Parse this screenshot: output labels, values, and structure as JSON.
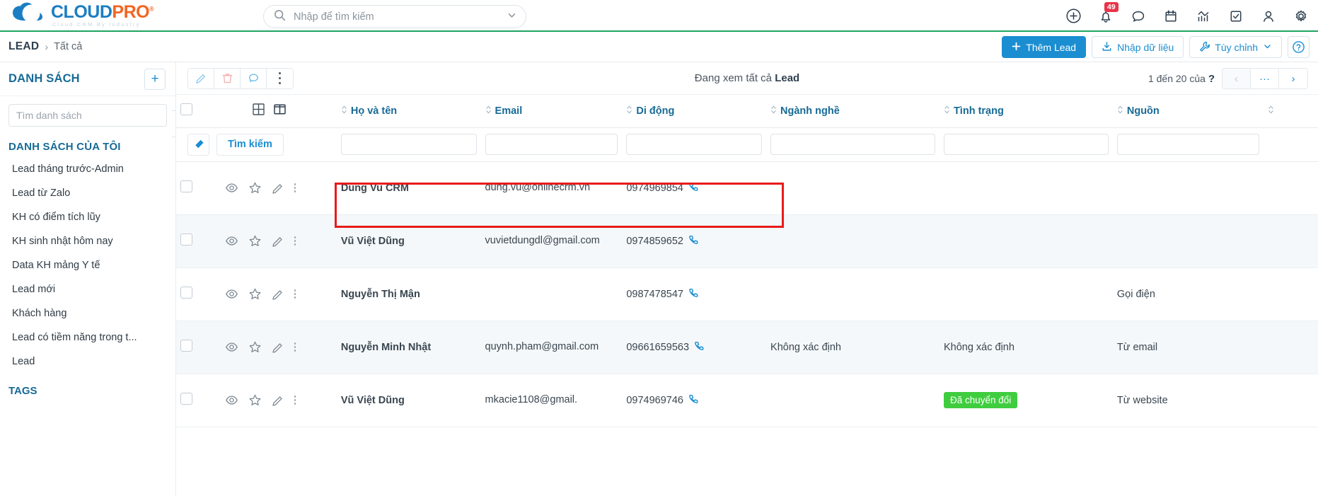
{
  "brand": {
    "name_part1": "CLOUD",
    "name_part2": "PRO",
    "registered": "®",
    "tagline": "Cloud CRM By Industry"
  },
  "search": {
    "placeholder": "Nhập để tìm kiếm",
    "value": "",
    "icon": "search-icon",
    "chevron": "chevron-down-icon"
  },
  "top_icons": [
    {
      "name": "add-circle-icon",
      "label": ""
    },
    {
      "name": "bell-icon",
      "label": "",
      "badge": "49"
    },
    {
      "name": "chat-icon",
      "label": ""
    },
    {
      "name": "calendar-icon",
      "label": ""
    },
    {
      "name": "analytics-icon",
      "label": ""
    },
    {
      "name": "task-check-icon",
      "label": ""
    },
    {
      "name": "user-icon",
      "label": ""
    },
    {
      "name": "gear-icon",
      "label": ""
    }
  ],
  "breadcrumb": {
    "root": "LEAD",
    "separator": "›",
    "current": "Tất cả"
  },
  "header_actions": {
    "add_lead": "Thêm Lead",
    "import": "Nhập dữ liệu",
    "customize": "Tùy chỉnh",
    "help": "?"
  },
  "sidebar": {
    "title": "DANH SÁCH",
    "add_button": "+",
    "search_placeholder": "Tìm danh sách",
    "search_value": "",
    "section_my_lists": "DANH SÁCH CỦA TÔI",
    "items": [
      {
        "label": "Lead tháng trước-Admin"
      },
      {
        "label": "Lead từ Zalo"
      },
      {
        "label": "KH có điểm tích lũy"
      },
      {
        "label": "KH sinh nhật hôm nay"
      },
      {
        "label": "Data KH mảng Y tế"
      },
      {
        "label": "Lead mới"
      },
      {
        "label": "Khách hàng"
      },
      {
        "label": "Lead có tiềm năng trong t..."
      },
      {
        "label": "Lead"
      }
    ],
    "section_tags": "TAGS"
  },
  "main": {
    "toolbar_icons": [
      {
        "name": "edit-pencil-icon"
      },
      {
        "name": "delete-trash-icon"
      },
      {
        "name": "comment-icon"
      },
      {
        "name": "more-vertical-icon"
      }
    ],
    "viewing_prefix": "Đang xem tất cả",
    "viewing_entity": "Lead",
    "pagination": {
      "range_prefix": "1 đến 20 của",
      "total": "?",
      "prev": "‹",
      "more": "···",
      "next": "›"
    },
    "filter": {
      "clear_icon": "eraser-icon",
      "search_label": "Tìm kiếm",
      "values": [
        "",
        "",
        "",
        "",
        "",
        "",
        ""
      ]
    },
    "columns": [
      {
        "key": "name",
        "label": "Họ và tên",
        "sortable": true
      },
      {
        "key": "email",
        "label": "Email",
        "sortable": true
      },
      {
        "key": "phone",
        "label": "Di động",
        "sortable": true
      },
      {
        "key": "industry",
        "label": "Ngành nghề",
        "sortable": true
      },
      {
        "key": "status",
        "label": "Tình trạng",
        "sortable": true
      },
      {
        "key": "source",
        "label": "Nguồn",
        "sortable": true
      }
    ],
    "rows": [
      {
        "name": "Dung Vu CRM",
        "email": "dung.vu@onlinecrm.vn",
        "phone": "0974969854",
        "industry": "",
        "status": "",
        "source": "",
        "extra": "",
        "highlighted": true
      },
      {
        "name": "Vũ Việt Dũng",
        "email": "vuvietdungdl@gmail.com",
        "phone": "0974859652",
        "industry": "",
        "status": "",
        "source": "",
        "extra": "",
        "highlighted": false
      },
      {
        "name": "Nguyễn Thị Mận",
        "email": "",
        "phone": "0987478547",
        "industry": "",
        "status": "",
        "source": "Gọi điện",
        "extra": "",
        "highlighted": false
      },
      {
        "name": "Nguyễn Minh Nhật",
        "email": "quynh.pham@gmail.com",
        "phone": "09661659563",
        "industry": "Không xác định",
        "status": "Không xác định",
        "source": "Từ email",
        "extra": "",
        "highlighted": false
      },
      {
        "name": "Vũ Việt Dũng",
        "email": "mkacie1108@gmail.",
        "phone": "0974969746",
        "industry": "",
        "status": "Đã chuyển đổi",
        "status_badge": true,
        "source": "Từ website",
        "extra": "",
        "highlighted": false
      }
    ],
    "row_action_icons": [
      {
        "name": "eye-view-icon"
      },
      {
        "name": "star-favorite-icon"
      },
      {
        "name": "edit-pencil-icon"
      },
      {
        "name": "more-vertical-icon"
      }
    ],
    "view_toggle_icons": [
      {
        "name": "grid-view-icon"
      },
      {
        "name": "split-view-icon"
      }
    ]
  },
  "colors": {
    "brand_blue": "#1b7ec2",
    "brand_orange": "#f26522",
    "primary": "#1b8ed1",
    "accent_green": "#1fa463",
    "badge_red": "#e8344a",
    "status_green": "#3fcd3f",
    "highlight_red": "#e81b1b"
  }
}
